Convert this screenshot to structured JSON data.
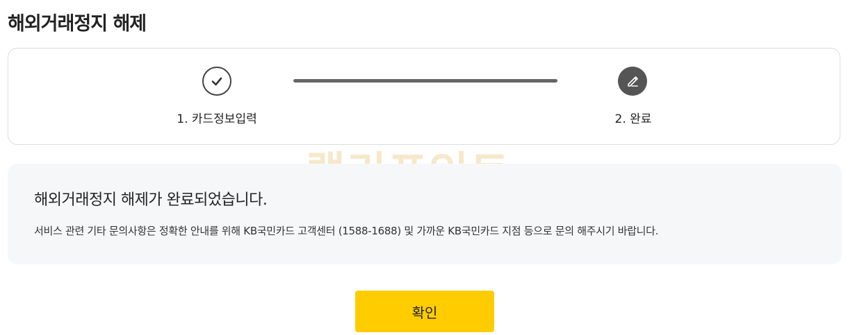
{
  "page": {
    "title": "해외거래정지 해제"
  },
  "stepper": {
    "steps": [
      {
        "label": "1. 카드정보입력",
        "icon": "check-circle-icon",
        "status": "done"
      },
      {
        "label": "2. 완료",
        "icon": "pencil-icon",
        "status": "current"
      }
    ]
  },
  "watermark": {
    "text": "랠리포인트"
  },
  "info": {
    "heading": "해외거래정지 해제가 완료되었습니다.",
    "description": "서비스 관련 기타 문의사항은 정확한 안내를 위해 KB국민카드 고객센터 (1588-1688) 및 가까운 KB국민카드 지점 등으로 문의 해주시기 바랍니다."
  },
  "actions": {
    "confirm_label": "확인"
  },
  "colors": {
    "accent": "#ffcc00",
    "step_done": "#444444",
    "step_current": "#555555",
    "progress_line": "#666666",
    "info_background": "#f6f7f9"
  }
}
